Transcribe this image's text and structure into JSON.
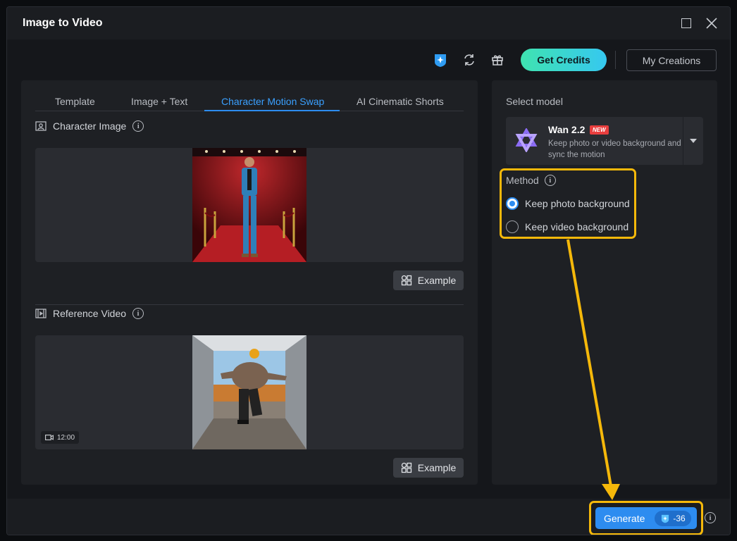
{
  "window": {
    "title": "Image to Video"
  },
  "topbar": {
    "get_credits_label": "Get Credits",
    "my_creations_label": "My Creations"
  },
  "tabs": [
    {
      "label": "Template",
      "active": false
    },
    {
      "label": "Image + Text",
      "active": false
    },
    {
      "label": "Character Motion Swap",
      "active": true
    },
    {
      "label": "AI Cinematic Shorts",
      "active": false
    }
  ],
  "character_image": {
    "label": "Character Image",
    "example_label": "Example"
  },
  "reference_video": {
    "label": "Reference Video",
    "duration": "12:00",
    "example_label": "Example"
  },
  "model": {
    "section_label": "Select model",
    "name": "Wan 2.2",
    "badge": "NEW",
    "description": "Keep photo or video background and sync the motion"
  },
  "method": {
    "label": "Method",
    "options": [
      {
        "label": "Keep photo background",
        "selected": true
      },
      {
        "label": "Keep video background",
        "selected": false
      }
    ]
  },
  "footer": {
    "generate_label": "Generate",
    "cost": "-36"
  },
  "colors": {
    "accent": "#2d8cf0",
    "highlight": "#f5b80a",
    "credits_gradient_start": "#3fe3b0",
    "credits_gradient_end": "#36c8f0"
  }
}
